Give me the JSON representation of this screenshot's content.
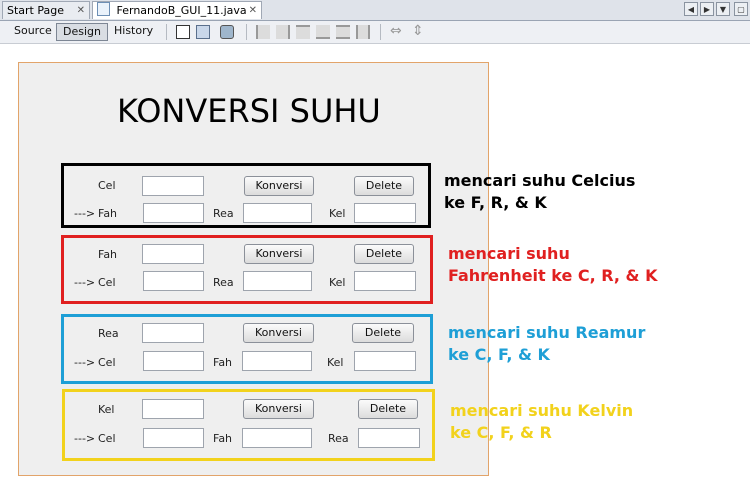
{
  "tabs": {
    "start_page": "Start Page",
    "active_file": "FernandoB_GUI_11.java",
    "close_glyph": "✕"
  },
  "toolbar": {
    "source": "Source",
    "design": "Design",
    "history": "History"
  },
  "form": {
    "title": "KONVERSI SUHU",
    "convert_label": "Konversi",
    "delete_label": "Delete",
    "arrow": "--->",
    "groups": [
      {
        "color": "#000000",
        "input_label": "Cel",
        "outputs": [
          "Fah",
          "Rea",
          "Kel"
        ],
        "note_line1": "mencari suhu Celcius",
        "note_line2": "ke F, R, & K"
      },
      {
        "color": "#e02020",
        "input_label": "Fah",
        "outputs": [
          "Cel",
          "Rea",
          "Kel"
        ],
        "note_line1": "mencari suhu",
        "note_line2": "Fahrenheit ke C, R, & K"
      },
      {
        "color": "#1e9fd6",
        "input_label": "Rea",
        "outputs": [
          "Cel",
          "Fah",
          "Kel"
        ],
        "note_line1": "mencari suhu Reamur",
        "note_line2": "ke C, F, & K"
      },
      {
        "color": "#f2d21c",
        "input_label": "Kel",
        "outputs": [
          "Cel",
          "Fah",
          "Rea"
        ],
        "note_line1": "mencari suhu Kelvin",
        "note_line2": "ke C, F, & R"
      }
    ]
  }
}
